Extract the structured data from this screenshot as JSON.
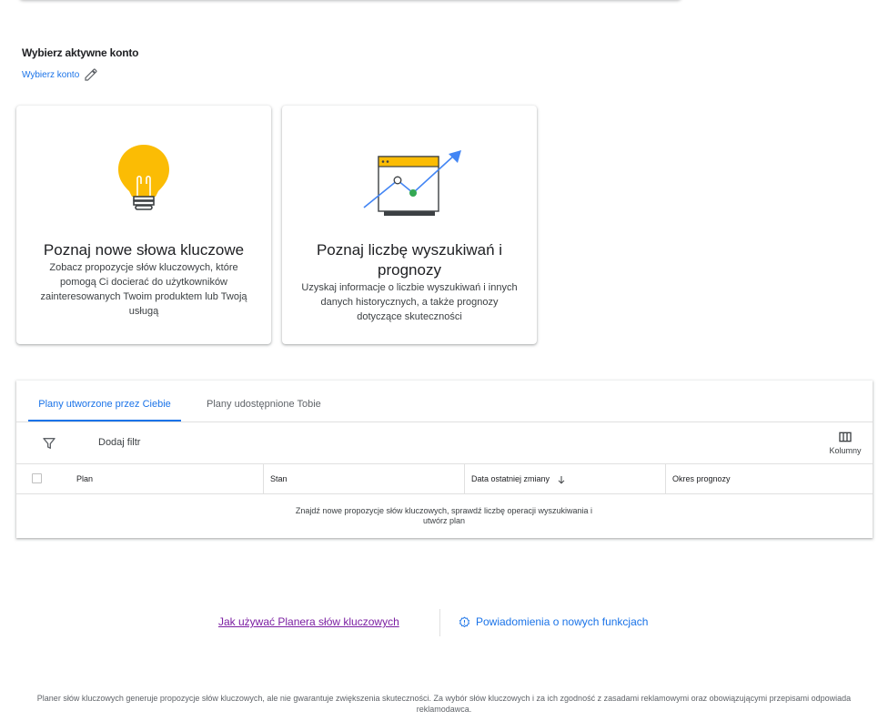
{
  "account": {
    "title": "Wybierz aktywne konto",
    "link_label": "Wybierz konto"
  },
  "cards": [
    {
      "title": "Poznaj nowe słowa kluczowe",
      "description": "Zobacz propozycje słów kluczowych, które pomogą Ci docierać do użytkowników zainteresowanych Twoim produktem lub Twoją usługą",
      "icon": "lightbulb-icon"
    },
    {
      "title": "Poznaj liczbę wyszukiwań i prognozy",
      "description": "Uzyskaj informacje o liczbie wyszukiwań i innych danych historycznych, a także prognozy dotyczące skuteczności",
      "icon": "trend-chart-icon"
    }
  ],
  "plans": {
    "tabs": [
      {
        "label": "Plany utworzone przez Ciebie",
        "active": true
      },
      {
        "label": "Plany udostępnione Tobie",
        "active": false
      }
    ],
    "add_filter_label": "Dodaj filtr",
    "columns_label": "Kolumny",
    "headers": {
      "plan": "Plan",
      "status": "Stan",
      "last_modified": "Data ostatniej zmiany",
      "forecast_period": "Okres prognozy"
    },
    "empty_message": "Znajdź nowe propozycje słów kluczowych, sprawdź liczbę operacji wyszukiwania i utwórz plan"
  },
  "footer": {
    "help_link": "Jak używać Planera słów kluczowych",
    "notifications_link": "Powiadomienia o nowych funkcjach",
    "disclaimer": "Planer słów kluczowych generuje propozycje słów kluczowych, ale nie gwarantuje zwiększenia skuteczności. Za wybór słów kluczowych i za ich zgodność z zasadami reklamowymi oraz obowiązującymi przepisami odpowiada reklamodawca."
  },
  "colors": {
    "accent": "#1a73e8",
    "visited_link": "#7b1fa2",
    "bulb_yellow": "#fbbc04",
    "chart_green": "#34a853"
  }
}
